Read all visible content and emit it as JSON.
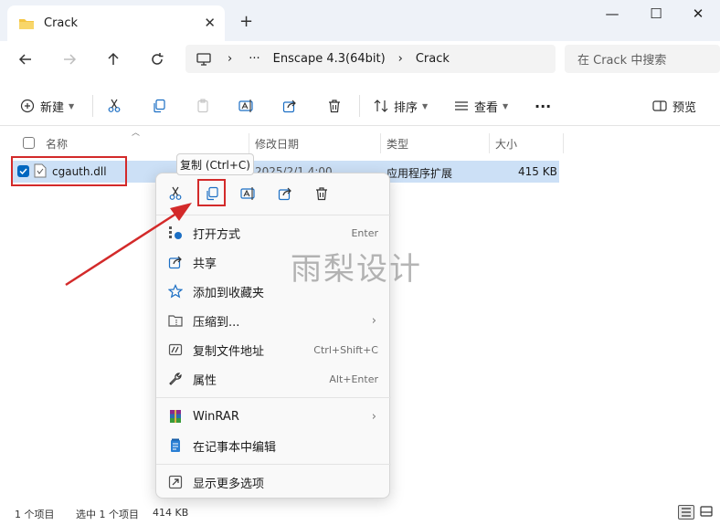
{
  "window": {
    "tab_title": "Crack",
    "tab_close": "✕",
    "new_tab": "+",
    "minimize": "—",
    "maximize": "☐",
    "close": "✕"
  },
  "address": {
    "ellipsis": "···",
    "segments": [
      "Enscape 4.3(64bit)",
      "Crack"
    ],
    "separator": "›",
    "search_placeholder": "在 Crack 中搜索"
  },
  "toolbar": {
    "new_label": "新建",
    "sort_label": "排序",
    "view_label": "查看",
    "more_label": "···",
    "preview_label": "预览"
  },
  "columns": {
    "name": "名称",
    "date": "修改日期",
    "type": "类型",
    "size": "大小"
  },
  "file": {
    "name": "cgauth.dll",
    "date": "2025/2/1 4:00",
    "type": "应用程序扩展",
    "size": "415 KB"
  },
  "tooltip": "复制 (Ctrl+C)",
  "context_menu": {
    "items": [
      {
        "label": "打开方式",
        "shortcut": "Enter",
        "icon": "open-with-icon"
      },
      {
        "label": "共享",
        "shortcut": "",
        "icon": "share-icon"
      },
      {
        "label": "添加到收藏夹",
        "shortcut": "",
        "icon": "star-icon"
      },
      {
        "label": "压缩到...",
        "shortcut": "",
        "icon": "compress-icon",
        "submenu": true
      },
      {
        "label": "复制文件地址",
        "shortcut": "Ctrl+Shift+C",
        "icon": "copy-path-icon"
      },
      {
        "label": "属性",
        "shortcut": "Alt+Enter",
        "icon": "wrench-icon"
      },
      {
        "label": "WinRAR",
        "shortcut": "",
        "icon": "winrar-icon",
        "submenu": true
      },
      {
        "label": "在记事本中编辑",
        "shortcut": "",
        "icon": "notepad-icon"
      },
      {
        "label": "显示更多选项",
        "shortcut": "",
        "icon": "more-options-icon"
      }
    ],
    "submenu_arrow": "›"
  },
  "status": {
    "count": "1 个项目",
    "selected": "选中 1 个项目",
    "selected_size": "414 KB"
  },
  "watermark": "雨梨设计",
  "colors": {
    "accent": "#0067c0",
    "selection": "#cce0f6",
    "highlight": "#d32a2a"
  }
}
